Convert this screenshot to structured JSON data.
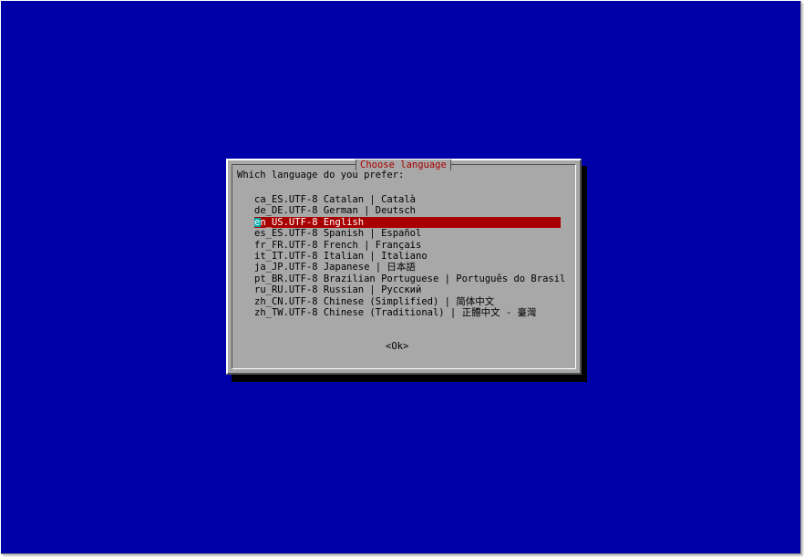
{
  "dialog": {
    "title": "Choose language",
    "prompt": "Which language do you prefer:",
    "options": [
      "ca_ES.UTF-8 Catalan | Català",
      "de_DE.UTF-8 German | Deutsch",
      "en_US.UTF-8 English",
      "es_ES.UTF-8 Spanish | Español",
      "fr_FR.UTF-8 French | Français",
      "it_IT.UTF-8 Italian | Italiano",
      "ja_JP.UTF-8 Japanese | 日本語",
      "pt_BR.UTF-8 Brazilian Portuguese | Português do Brasil",
      "ru_RU.UTF-8 Russian | Русский",
      "zh_CN.UTF-8 Chinese (Simplified) | 简体中文",
      "zh_TW.UTF-8 Chinese (Traditional) | 正體中文 - 臺灣"
    ],
    "selected_option": "en_US.UTF-8 English",
    "ok_label": "<Ok>"
  },
  "colors": {
    "screen_background": "#0000a8",
    "dialog_background": "#a8a8a8",
    "title_text": "#a80000",
    "highlight": "#a80000",
    "cursor": "#00a8a8"
  }
}
